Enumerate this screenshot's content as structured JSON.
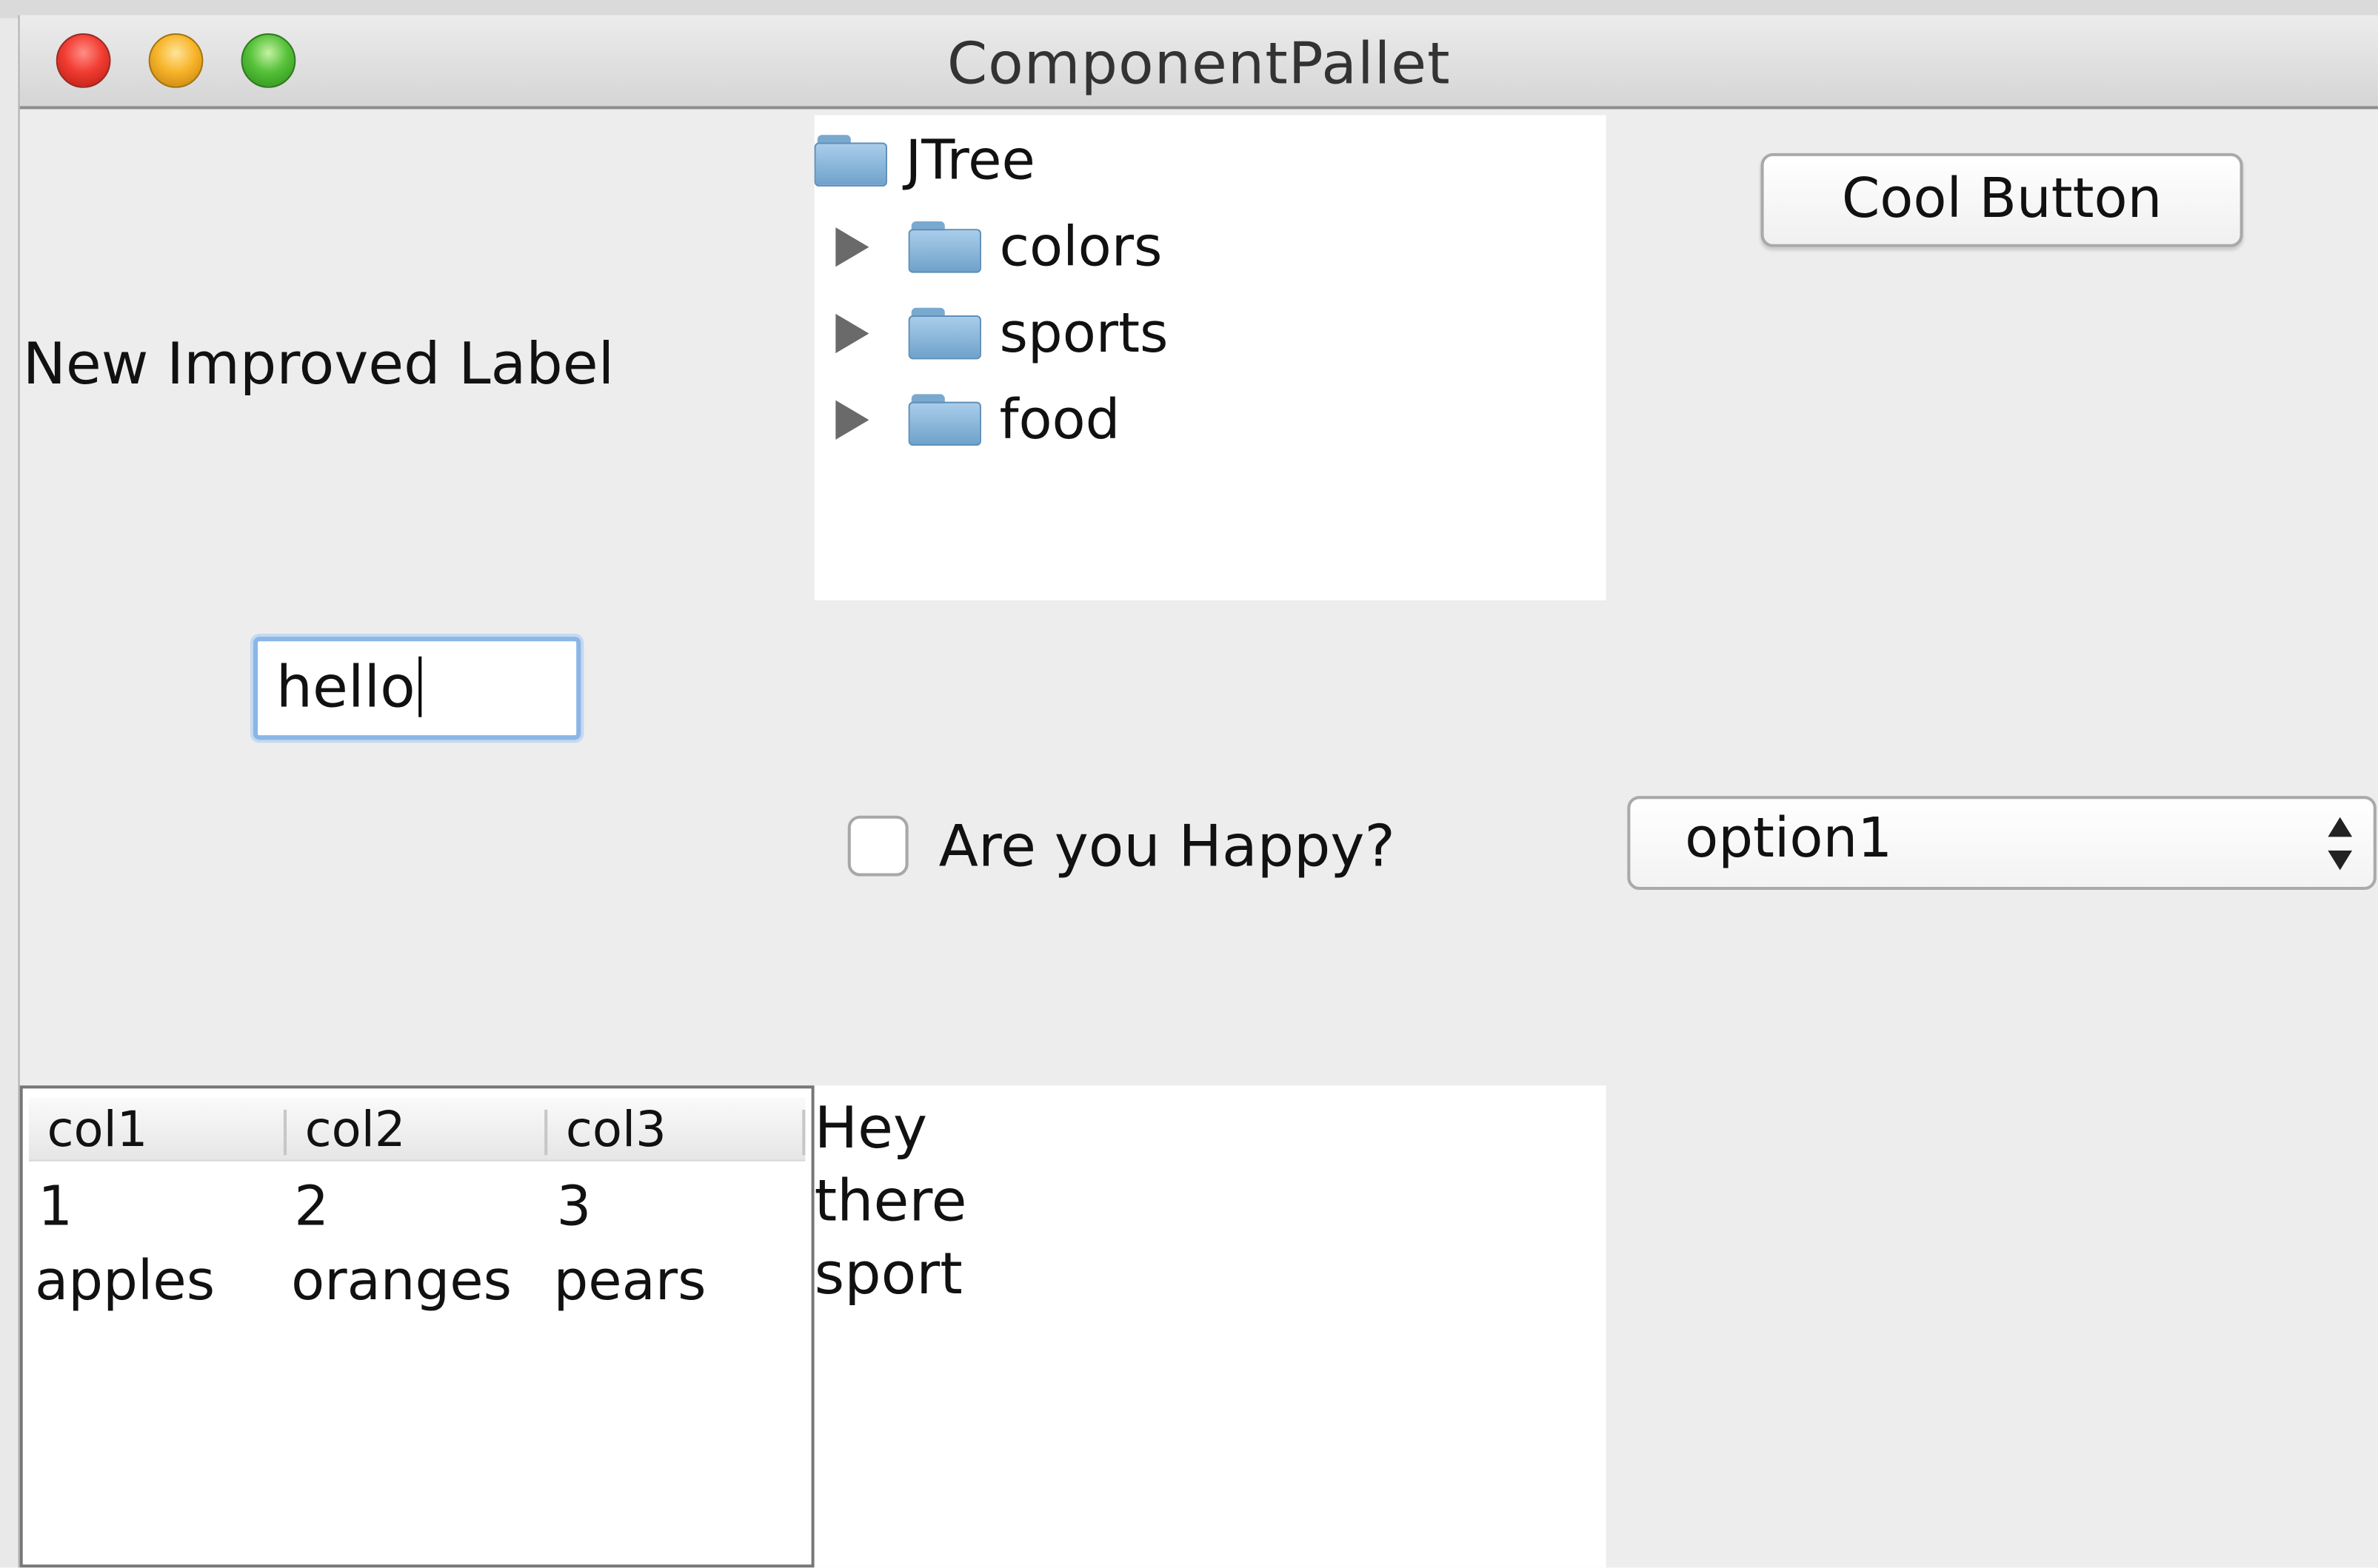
{
  "window": {
    "title": "ComponentPallet"
  },
  "label": {
    "text": "New Improved Label"
  },
  "textfield": {
    "value": "hello"
  },
  "tree": {
    "root": "JTree",
    "children": [
      "colors",
      "sports",
      "food"
    ]
  },
  "button": {
    "label": "Cool Button"
  },
  "checkbox": {
    "label": "Are you Happy?",
    "checked": false
  },
  "combo": {
    "selected": "option1"
  },
  "table": {
    "columns": [
      "col1",
      "col2",
      "col3"
    ],
    "rows": [
      [
        "1",
        "2",
        "3"
      ],
      [
        "apples",
        "oranges",
        "pears"
      ]
    ]
  },
  "textarea": {
    "lines": [
      "Hey",
      "there",
      "sport"
    ]
  }
}
